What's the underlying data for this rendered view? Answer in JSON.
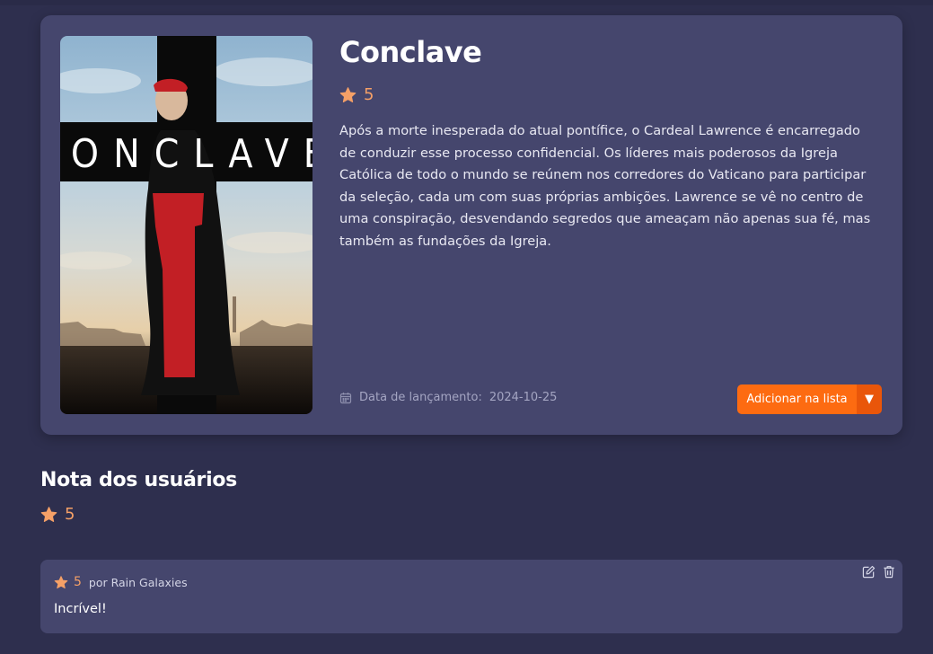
{
  "colors": {
    "background": "#2e2f4e",
    "card": "#45466d",
    "accent": "#fd6b11",
    "star": "#f5a067"
  },
  "movie": {
    "title": "Conclave",
    "rating": "5",
    "poster_title": "CONCLAVE",
    "synopsis": "Após a morte inesperada do atual pontífice, o Cardeal Lawrence é encarregado de conduzir esse processo confidencial. Os líderes mais poderosos da Igreja Católica de todo o mundo se reúnem nos corredores do Vaticano para participar da seleção, cada um com suas próprias ambições. Lawrence se vê no centro de uma conspiração, desvendando segredos que ameaçam não apenas sua fé, mas também as fundações da Igreja.",
    "release_label": "Data de lançamento:",
    "release_date": "2024-10-25",
    "add_button_label": "Adicionar na lista",
    "dropdown_glyph": "▼"
  },
  "user_ratings": {
    "heading": "Nota dos usuários",
    "rating": "5"
  },
  "reviews": [
    {
      "score": "5",
      "author": "por Rain Galaxies",
      "text": "Incrível!"
    }
  ],
  "icons": {
    "star": "star-icon",
    "calendar": "calendar-icon",
    "edit": "edit-icon",
    "delete": "trash-icon"
  }
}
